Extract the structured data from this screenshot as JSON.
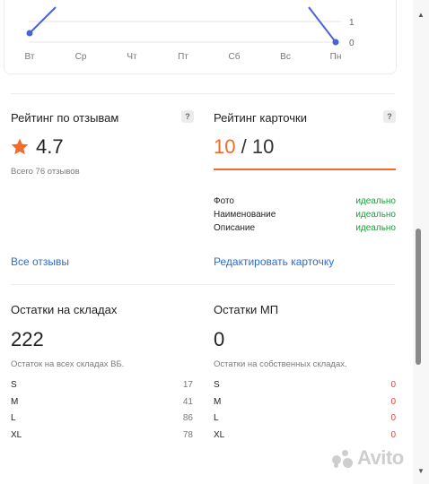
{
  "weekday_chart": {
    "days": [
      "Вт",
      "Ср",
      "Чт",
      "Пт",
      "Сб",
      "Вс",
      "Пн"
    ],
    "y_ticks": [
      "1",
      "0"
    ],
    "line_color": "#4a63d6"
  },
  "reviews": {
    "title": "Рейтинг по отзывам",
    "help": "?",
    "rating": "4.7",
    "star_color": "#f26b2a",
    "total": "Всего 76 отзывов",
    "link": "Все отзывы"
  },
  "card_rating": {
    "title": "Рейтинг карточки",
    "help": "?",
    "score": "10",
    "separator": "/",
    "max": "10",
    "score_color": "#f26b2a",
    "bar_fraction": 1.0,
    "rows": [
      {
        "label": "Фото",
        "status": "идеально"
      },
      {
        "label": "Наименование",
        "status": "идеально"
      },
      {
        "label": "Описание",
        "status": "идеально"
      }
    ],
    "link": "Редактировать карточку"
  },
  "stock_warehouses": {
    "title": "Остатки на складах",
    "total": "222",
    "subtitle": "Остаток на всех складах ВБ.",
    "sizes": [
      {
        "size": "S",
        "count": "17"
      },
      {
        "size": "M",
        "count": "41"
      },
      {
        "size": "L",
        "count": "86"
      },
      {
        "size": "XL",
        "count": "78"
      }
    ]
  },
  "stock_mp": {
    "title": "Остатки МП",
    "total": "0",
    "subtitle": "Остатки на собственных складах.",
    "sizes": [
      {
        "size": "S",
        "count": "0"
      },
      {
        "size": "M",
        "count": "0"
      },
      {
        "size": "L",
        "count": "0"
      },
      {
        "size": "XL",
        "count": "0"
      }
    ]
  },
  "watermark": "Avito"
}
